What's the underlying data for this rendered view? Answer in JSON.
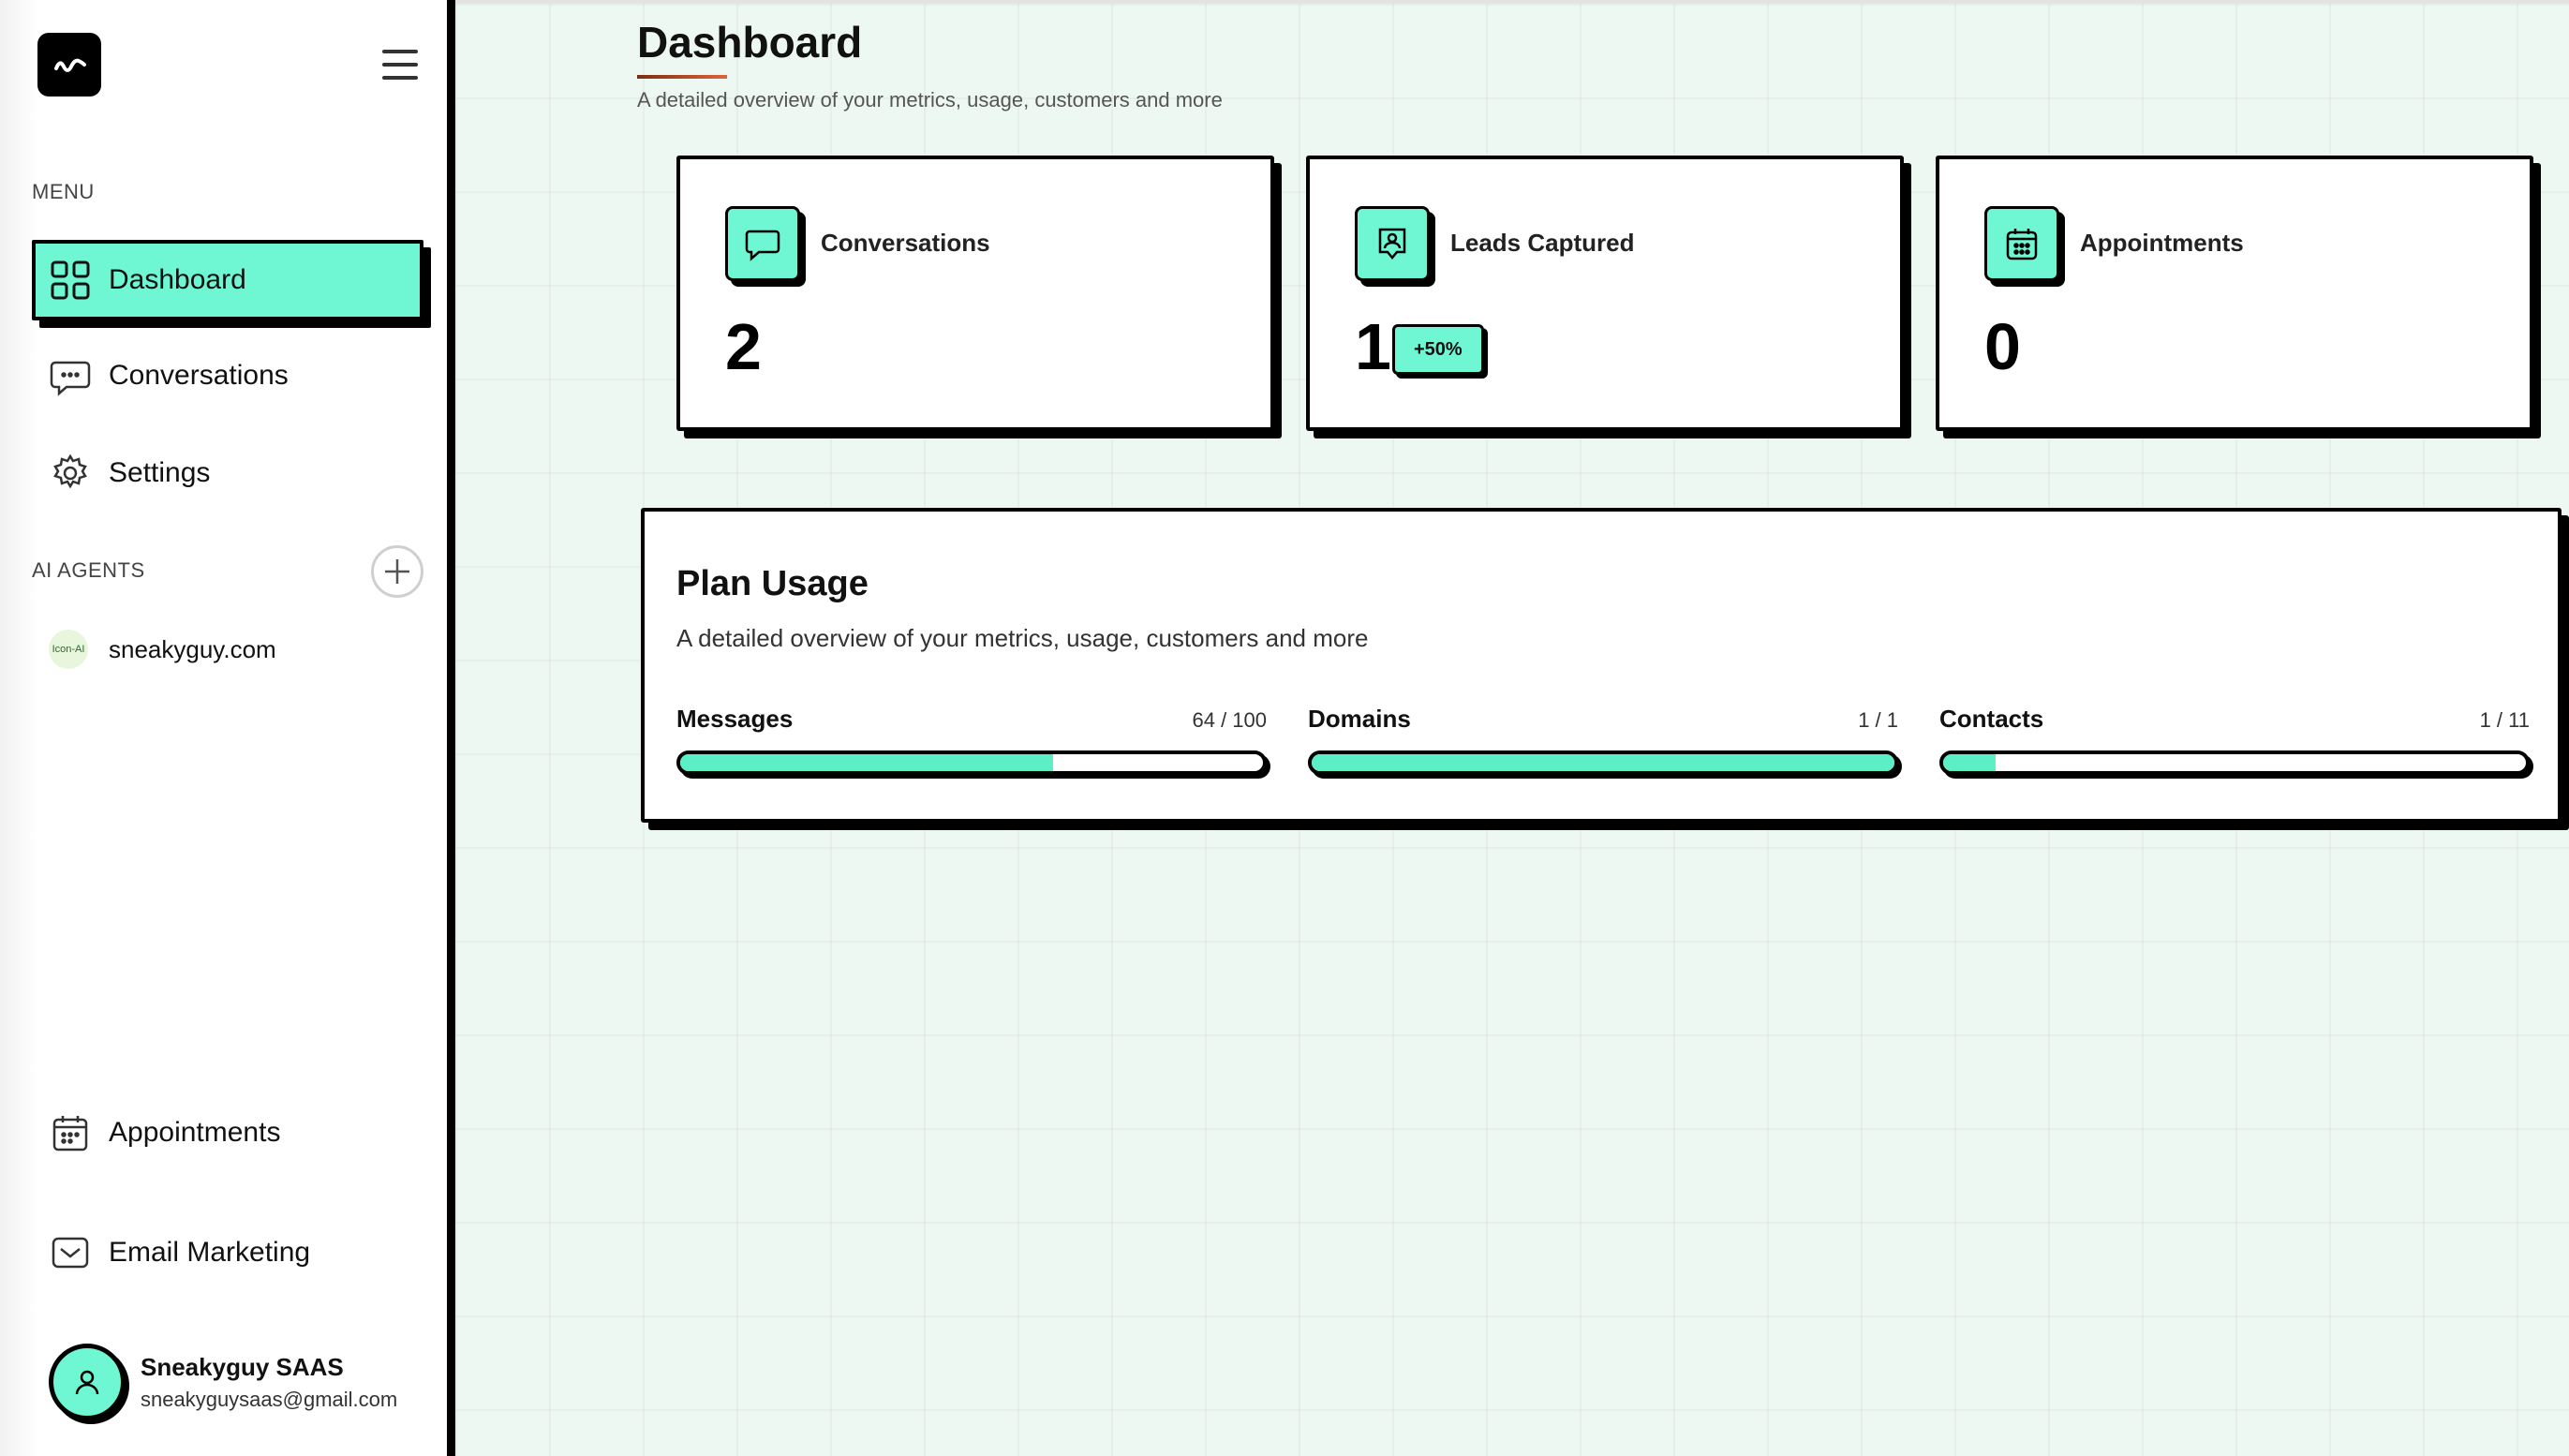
{
  "sidebar": {
    "menu_label": "MENU",
    "nav": [
      {
        "label": "Dashboard",
        "icon": "grid-icon",
        "active": true
      },
      {
        "label": "Conversations",
        "icon": "chat-bubble-icon"
      },
      {
        "label": "Settings",
        "icon": "gear-icon"
      }
    ],
    "agents_label": "AI AGENTS",
    "agents": [
      {
        "name": "sneakyguy.com",
        "avatar_text": "Icon-AI"
      }
    ],
    "bottom_nav": [
      {
        "label": "Appointments",
        "icon": "calendar-icon"
      },
      {
        "label": "Email Marketing",
        "icon": "mail-icon"
      }
    ],
    "user": {
      "name": "Sneakyguy SAAS",
      "email": "sneakyguysaas@gmail.com"
    }
  },
  "header": {
    "title": "Dashboard",
    "subtitle": "A detailed overview of your metrics, usage, customers and more"
  },
  "stats": [
    {
      "label": "Conversations",
      "value": "2",
      "icon": "message-square-icon"
    },
    {
      "label": "Leads Captured",
      "value": "1",
      "badge": "+50%",
      "icon": "user-badge-icon"
    },
    {
      "label": "Appointments",
      "value": "0",
      "icon": "calendar-icon"
    }
  ],
  "plan_usage": {
    "title": "Plan Usage",
    "subtitle": "A detailed overview of your metrics, usage, customers and more",
    "meters": [
      {
        "label": "Messages",
        "count": "64 / 100",
        "fraction": 0.64
      },
      {
        "label": "Domains",
        "count": "1 / 1",
        "fraction": 1.0
      },
      {
        "label": "Contacts",
        "count": "1 / 11",
        "fraction": 0.09
      }
    ]
  },
  "colors": {
    "accent": "#6ef7d2",
    "border": "#000000",
    "background": "#eef8f3"
  }
}
